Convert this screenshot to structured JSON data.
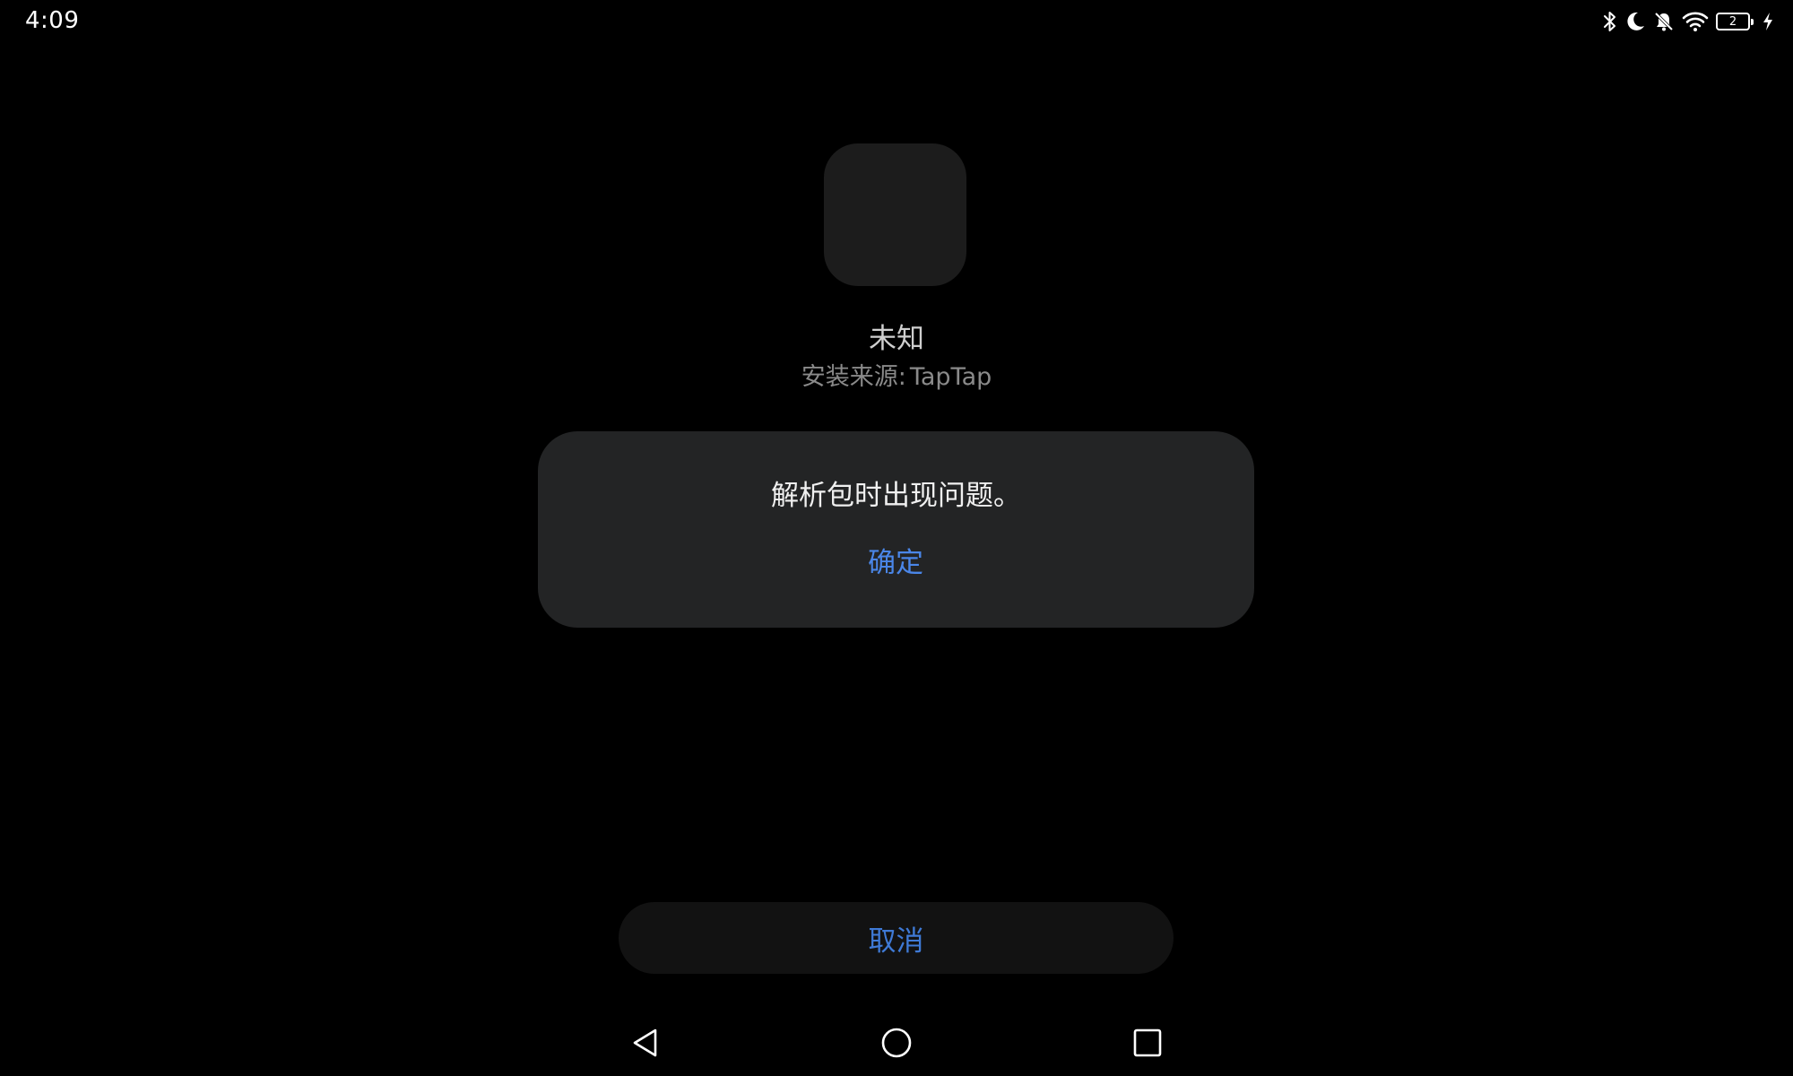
{
  "status_bar": {
    "time": "4:09",
    "battery_level": "2",
    "icons": [
      "bluetooth-icon",
      "do-not-disturb-moon-icon",
      "bell-muted-icon",
      "wifi-icon",
      "battery-icon",
      "charging-bolt-icon"
    ]
  },
  "app": {
    "name": "未知",
    "install_source_label": "安装来源:",
    "install_source_value": "TapTap"
  },
  "dialog": {
    "message": "解析包时出现问题。",
    "confirm_label": "确定"
  },
  "cancel_label": "取消",
  "navigation": {
    "icons": [
      "back-icon",
      "home-icon",
      "recents-icon"
    ]
  },
  "colors": {
    "background": "#000000",
    "dialog_bg": "#232425",
    "accent_blue": "#4a86e8",
    "cancel_bg": "#121212"
  }
}
